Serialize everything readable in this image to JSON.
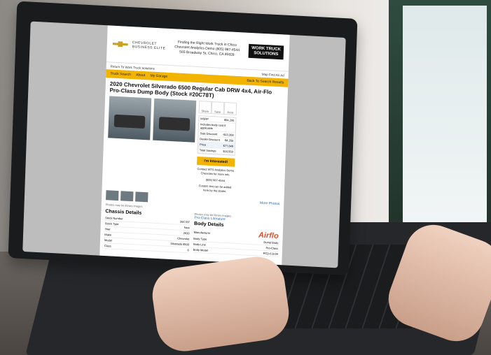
{
  "header": {
    "brand_primary": "CHEVROLET",
    "brand_secondary": "BUSINESS ELITE",
    "center_line1": "Finding the Right Work Truck in Chico",
    "center_line2": "Chevrolet Analytics Demo (805) 987-4544",
    "center_line3": "565 Broadway St, Chico, CA 95928",
    "logo_line1": "WORK TRUCK",
    "logo_line2": "SOLUTIONS"
  },
  "topnav": {
    "return_link": "Return To Work Truck Solutions",
    "map_label": "Map",
    "find_label": "Find An Ad"
  },
  "nav": {
    "items": [
      "Truck Search",
      "About",
      "My Garage"
    ],
    "back_link": "Back To Search Results"
  },
  "listing": {
    "title": "2020 Chevrolet Silverado 6500 Regular Cab DRW 4x4, Air-Flo Pro-Class Dump Body (Stock #20C78T)",
    "photos_note": "Photos may be library images",
    "more_photos": "More Photos",
    "body_photo_note": "Photos may be library images",
    "body_link": "Pro-Class Literature"
  },
  "actions": {
    "share": "Share",
    "save": "Save",
    "print": "Print"
  },
  "pricing": {
    "msrp_label": "MSRP",
    "msrp_value": "$94,200",
    "msrp_note": "Includes body cost if applicable",
    "sale_label": "Sale Discount",
    "sale_value": "-$13,308",
    "dealer_label": "Dealer Discount",
    "dealer_value": "-$4,250",
    "price_label": "Price",
    "price_value": "$77,649",
    "savings_label": "Total Savings",
    "savings_value": "$16,558"
  },
  "cta": {
    "button": "I'm Interested!",
    "contact": "Contact WTS Analytics Demo Chevrolet for more info.",
    "phone": "(805) 987-4544",
    "custom_text": "Custom text can be added here by the dealer."
  },
  "chassis": {
    "heading": "Chassis Details",
    "rows": [
      {
        "k": "Stock Number",
        "v": "20C78T"
      },
      {
        "k": "Stock Type",
        "v": "New"
      },
      {
        "k": "Year",
        "v": "2020"
      },
      {
        "k": "Make",
        "v": "Chevrolet"
      },
      {
        "k": "Model",
        "v": "Silverado 6500"
      },
      {
        "k": "Class",
        "v": "6"
      }
    ]
  },
  "body": {
    "heading": "Body Details",
    "manufacturer_label": "Manufacturer",
    "brand_logo": "Airflo",
    "rows": [
      {
        "k": "Body Type",
        "v": "Dump Body"
      },
      {
        "k": "Body Line",
        "v": "Pro-Class"
      },
      {
        "k": "Body Model",
        "v": "PCD-6.5-09"
      }
    ]
  },
  "colors": {
    "accent": "#f2b400",
    "link": "#2b6cb0",
    "airflo": "#e4512b"
  }
}
